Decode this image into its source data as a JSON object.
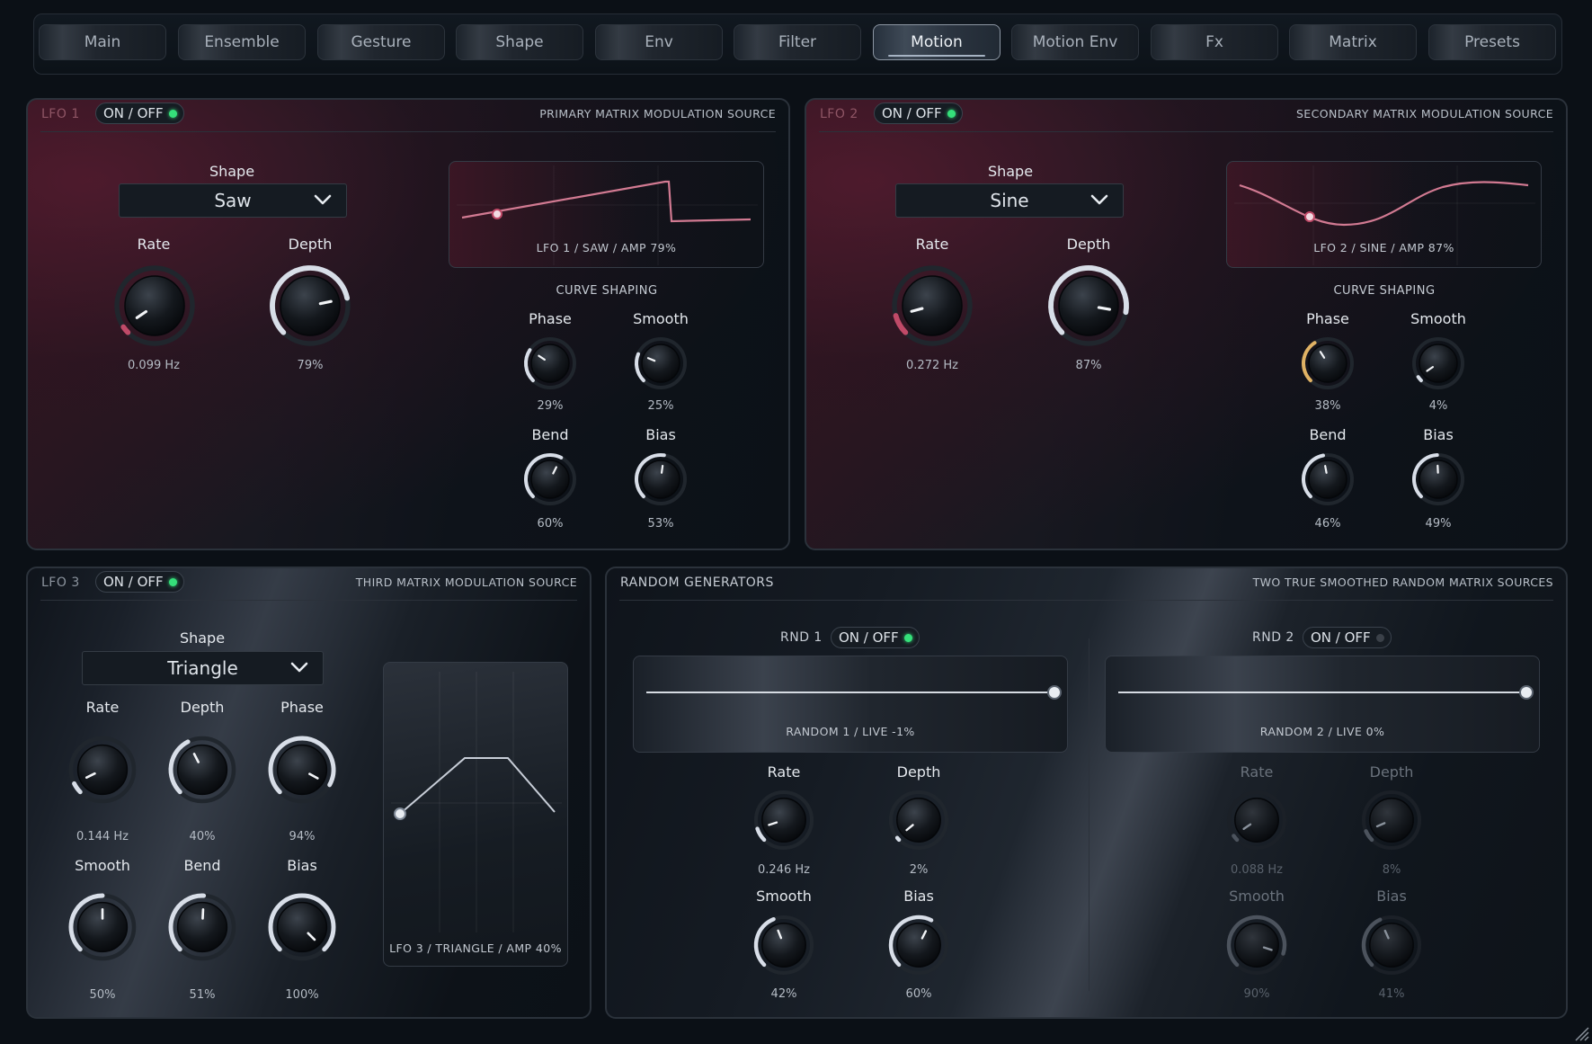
{
  "tabs": [
    {
      "label": "Main",
      "active": false
    },
    {
      "label": "Ensemble",
      "active": false
    },
    {
      "label": "Gesture",
      "active": false
    },
    {
      "label": "Shape",
      "active": false
    },
    {
      "label": "Env",
      "active": false
    },
    {
      "label": "Filter",
      "active": false
    },
    {
      "label": "Motion",
      "active": true
    },
    {
      "label": "Motion Env",
      "active": false
    },
    {
      "label": "Fx",
      "active": false
    },
    {
      "label": "Matrix",
      "active": false
    },
    {
      "label": "Presets",
      "active": false
    }
  ],
  "colors": {
    "accent_pink": "#c04a68",
    "accent_gold": "#e0b264",
    "led_on": "#35e07a",
    "arc_white": "#d8dee8"
  },
  "lfo1": {
    "title": "LFO 1",
    "toggle": "ON / OFF",
    "toggle_on": true,
    "subtitle": "PRIMARY MATRIX MODULATION SOURCE",
    "shape_label": "Shape",
    "shape_value": "Saw",
    "rate_label": "Rate",
    "rate_value": "0.099 Hz",
    "rate_level": 0.04,
    "depth_label": "Depth",
    "depth_value": "79%",
    "depth_level": 0.79,
    "wave_caption": "LFO 1 / SAW / AMP 79%",
    "curve_label": "CURVE SHAPING",
    "phase_label": "Phase",
    "phase_value": "29%",
    "phase_level": 0.29,
    "smooth_label": "Smooth",
    "smooth_value": "25%",
    "smooth_level": 0.25,
    "bend_label": "Bend",
    "bend_value": "60%",
    "bend_level": 0.6,
    "bias_label": "Bias",
    "bias_value": "53%",
    "bias_level": 0.53
  },
  "lfo2": {
    "title": "LFO 2",
    "toggle": "ON / OFF",
    "toggle_on": true,
    "subtitle": "SECONDARY MATRIX MODULATION SOURCE",
    "shape_label": "Shape",
    "shape_value": "Sine",
    "rate_label": "Rate",
    "rate_value": "0.272 Hz",
    "rate_level": 0.11,
    "depth_label": "Depth",
    "depth_value": "87%",
    "depth_level": 0.87,
    "wave_caption": "LFO 2 / SINE / AMP 87%",
    "curve_label": "CURVE SHAPING",
    "phase_label": "Phase",
    "phase_value": "38%",
    "phase_level": 0.38,
    "smooth_label": "Smooth",
    "smooth_value": "4%",
    "smooth_level": 0.04,
    "bend_label": "Bend",
    "bend_value": "46%",
    "bend_level": 0.46,
    "bias_label": "Bias",
    "bias_value": "49%",
    "bias_level": 0.49
  },
  "lfo3": {
    "title": "LFO 3",
    "toggle": "ON / OFF",
    "toggle_on": true,
    "subtitle": "THIRD MATRIX MODULATION SOURCE",
    "shape_label": "Shape",
    "shape_value": "Triangle",
    "rate_label": "Rate",
    "rate_value": "0.144 Hz",
    "rate_level": 0.07,
    "depth_label": "Depth",
    "depth_value": "40%",
    "depth_level": 0.4,
    "phase_label": "Phase",
    "phase_value": "94%",
    "phase_level": 0.94,
    "smooth_label": "Smooth",
    "smooth_value": "50%",
    "smooth_level": 0.5,
    "bend_label": "Bend",
    "bend_value": "51%",
    "bend_level": 0.51,
    "bias_label": "Bias",
    "bias_value": "100%",
    "bias_level": 1.0,
    "wave_caption": "LFO 3 / TRIANGLE / AMP 40%"
  },
  "random": {
    "title": "RANDOM GENERATORS",
    "subtitle": "TWO TRUE SMOOTHED RANDOM MATRIX SOURCES",
    "rnd1": {
      "title": "RND 1",
      "toggle": "ON / OFF",
      "toggle_on": true,
      "caption": "RANDOM 1 / LIVE -1%",
      "rate_label": "Rate",
      "rate_value": "0.246 Hz",
      "rate_level": 0.1,
      "depth_label": "Depth",
      "depth_value": "2%",
      "depth_level": 0.02,
      "smooth_label": "Smooth",
      "smooth_value": "42%",
      "smooth_level": 0.42,
      "bias_label": "Bias",
      "bias_value": "60%",
      "bias_level": 0.6
    },
    "rnd2": {
      "title": "RND 2",
      "toggle": "ON / OFF",
      "toggle_on": false,
      "caption": "RANDOM 2 / LIVE 0%",
      "rate_label": "Rate",
      "rate_value": "0.088 Hz",
      "rate_level": 0.04,
      "depth_label": "Depth",
      "depth_value": "8%",
      "depth_level": 0.08,
      "smooth_label": "Smooth",
      "smooth_value": "90%",
      "smooth_level": 0.9,
      "bias_label": "Bias",
      "bias_value": "41%",
      "bias_level": 0.41
    }
  }
}
